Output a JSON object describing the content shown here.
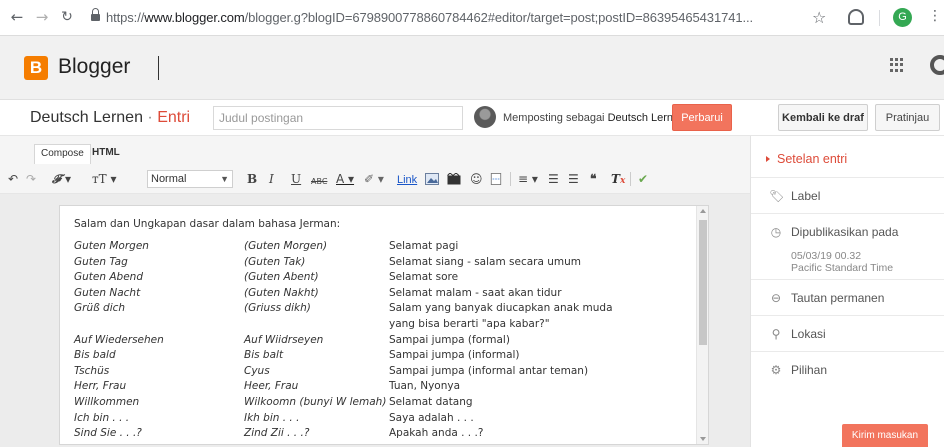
{
  "browser": {
    "url_prefix": "https://",
    "url_host": "www.blogger.com",
    "url_rest": "/blogger.g?blogID=6798900778860784462#editor/target=post;postID=86395465431741...",
    "profile_initial": "G"
  },
  "app": {
    "brand": "Blogger",
    "logo_letter": "B",
    "brand_color": "#f57d00"
  },
  "editor_header": {
    "blog_name": "Deutsch Lernen",
    "separator": "·",
    "section": "Entri",
    "title_placeholder": "Judul postingan",
    "posting_as": "Memposting sebagai",
    "posting_user": "Deutsch Lernen!",
    "update_button": "Perbarui",
    "revert_button": "Kembali ke draf",
    "preview_button": "Pratinjau"
  },
  "tabs": {
    "compose": "Compose",
    "html": "HTML"
  },
  "toolbar": {
    "font_size_value": "Normal",
    "link_label": "Link"
  },
  "document": {
    "intro": "Salam dan Ungkapan dasar dalam bahasa Jerman:",
    "rows": [
      {
        "de": "Guten Morgen",
        "pron": "(Guten Morgen)",
        "id": "Selamat pagi"
      },
      {
        "de": "Guten Tag",
        "pron": "(Guten Tak)",
        "id": "Selamat siang - salam secara umum"
      },
      {
        "de": "Guten Abend",
        "pron": "(Guten Abent)",
        "id": "Selamat sore"
      },
      {
        "de": "Guten Nacht",
        "pron": "(Guten Nakht)",
        "id": "Selamat malam - saat akan tidur"
      },
      {
        "de": "Grüß dich",
        "pron": "(Griuss dikh)",
        "id": "Salam yang banyak diucapkan anak muda",
        "id2": "yang bisa berarti \"apa kabar?\""
      },
      {
        "de": "Auf Wiedersehen",
        "pron": "Auf Wiidrseyen",
        "id": "Sampai jumpa (formal)"
      },
      {
        "de": "Bis bald",
        "pron": "Bis balt",
        "id": "Sampai jumpa (informal)"
      },
      {
        "de": "Tschüs",
        "pron": "Cyus",
        "id": "Sampai jumpa (informal antar teman)"
      },
      {
        "de": "Herr, Frau",
        "pron": "Heer, Frau",
        "id": "Tuan, Nyonya"
      },
      {
        "de": "Willkommen",
        "pron": "Wilkoomn (bunyi W lemah)",
        "id": "Selamat datang"
      },
      {
        "de": "Ich bin . . .",
        "pron": "Ikh bin . . .",
        "id": "Saya adalah . . ."
      },
      {
        "de": "Sind Sie . . .?",
        "pron": "Zind Zii . . .?",
        "id": "Apakah anda . . .?"
      }
    ]
  },
  "sidebar": {
    "header": "Setelan entri",
    "label": "Label",
    "published": "Dipublikasikan pada",
    "published_date": "05/03/19 00.32",
    "timezone": "Pacific Standard Time",
    "permalink": "Tautan permanen",
    "location": "Lokasi",
    "options": "Pilihan",
    "feedback_button": "Kirim masukan"
  },
  "colors": {
    "accent": "#dd4b39",
    "update_button": "#f2745d"
  }
}
